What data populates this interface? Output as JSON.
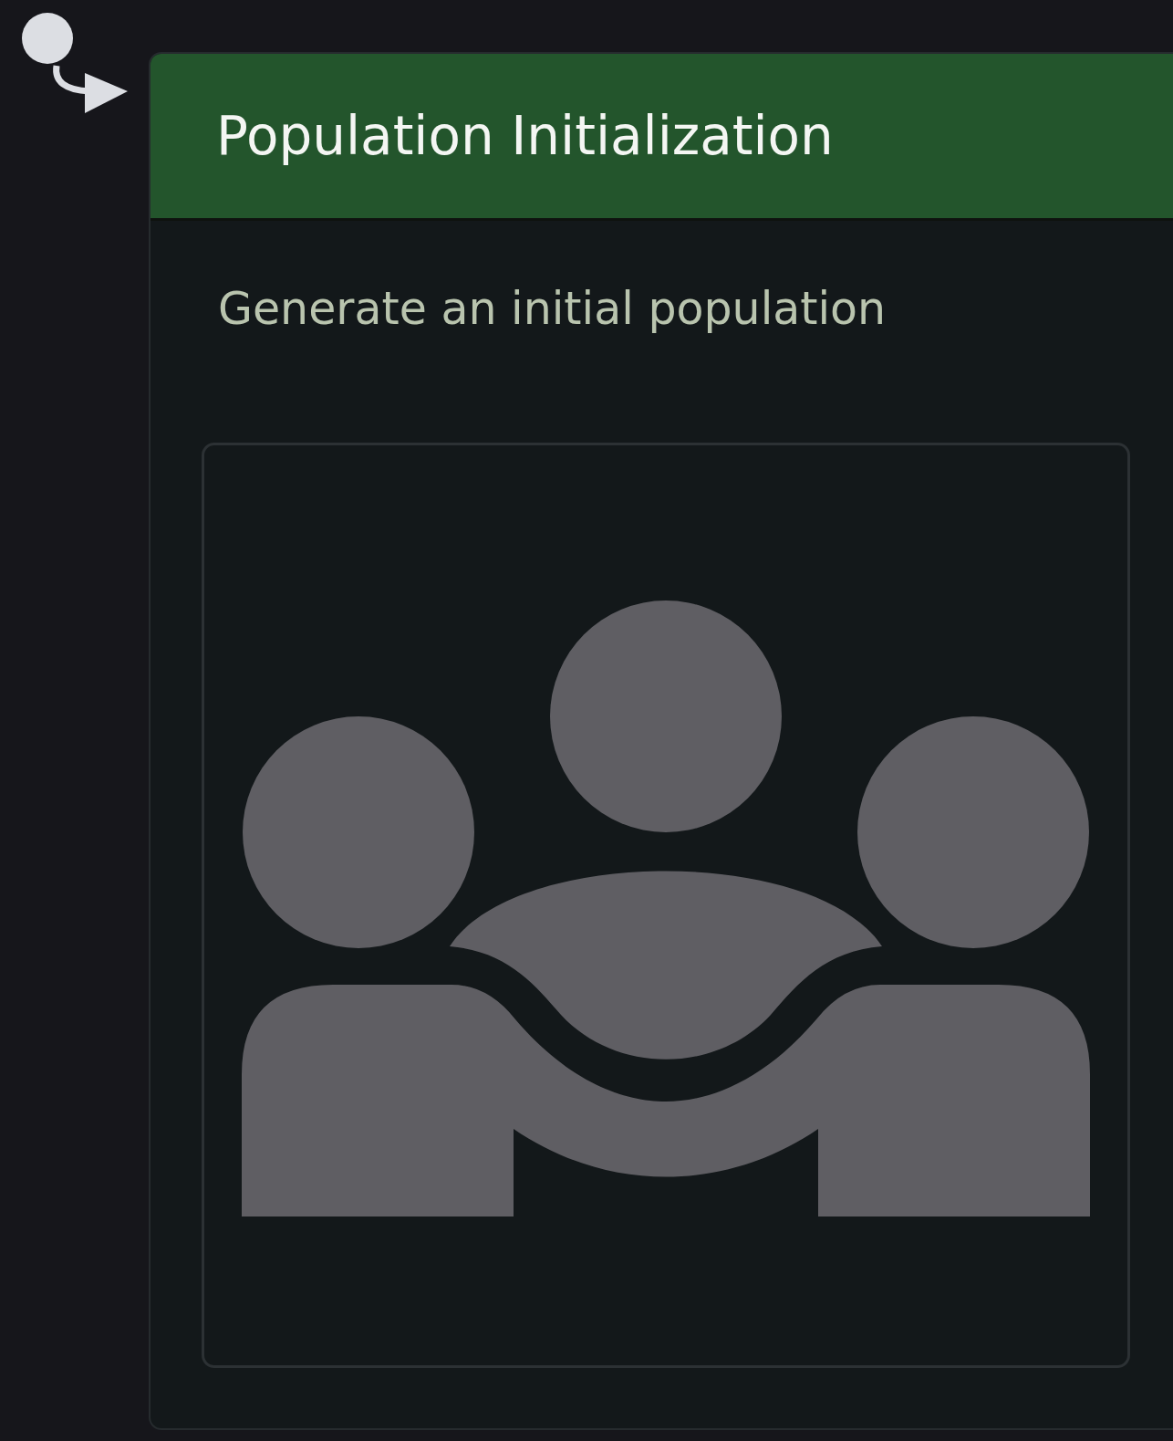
{
  "node": {
    "title": "Population Initialization",
    "description": "Generate an initial population"
  }
}
